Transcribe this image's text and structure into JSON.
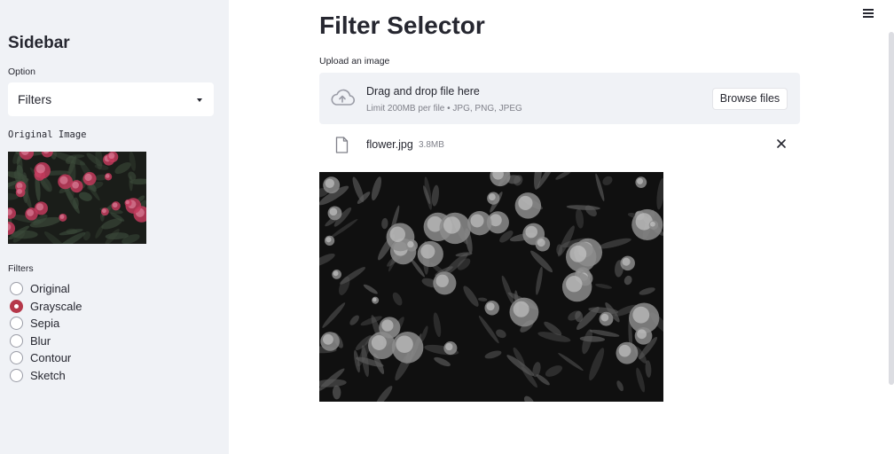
{
  "sidebar": {
    "title": "Sidebar",
    "option_label": "Option",
    "option_select": {
      "value": "Filters",
      "caret_icon": "chevron-down-icon"
    },
    "original_image_caption": "Original Image",
    "original_image": {
      "description": "photo",
      "colors": {
        "background": "#1a1d19",
        "flowers": "#c23a5c",
        "leaves": "#3b4a3a"
      }
    },
    "filters_label": "Filters",
    "filters": [
      {
        "label": "Original",
        "checked": false
      },
      {
        "label": "Grayscale",
        "checked": true
      },
      {
        "label": "Sepia",
        "checked": false
      },
      {
        "label": "Blur",
        "checked": false
      },
      {
        "label": "Contour",
        "checked": false
      },
      {
        "label": "Sketch",
        "checked": false
      }
    ]
  },
  "header": {
    "menu_icon": "hamburger-menu-icon"
  },
  "main": {
    "title": "Filter Selector",
    "upload": {
      "label": "Upload an image",
      "dropzone_title": "Drag and drop file here",
      "dropzone_limit": "Limit 200MB per file • JPG, PNG, JPEG",
      "browse_button": "Browse files",
      "upload_icon": "cloud-upload-icon"
    },
    "file": {
      "name": "flower.jpg",
      "size": "3.8MB",
      "file_icon": "file-icon",
      "remove_icon": "close-icon"
    },
    "result_image": {
      "description": "grayscale photo"
    }
  },
  "colors": {
    "accent": "#b5384a",
    "sidebar_bg": "#f0f2f6",
    "text": "#262730",
    "muted_text": "#7f8089"
  }
}
